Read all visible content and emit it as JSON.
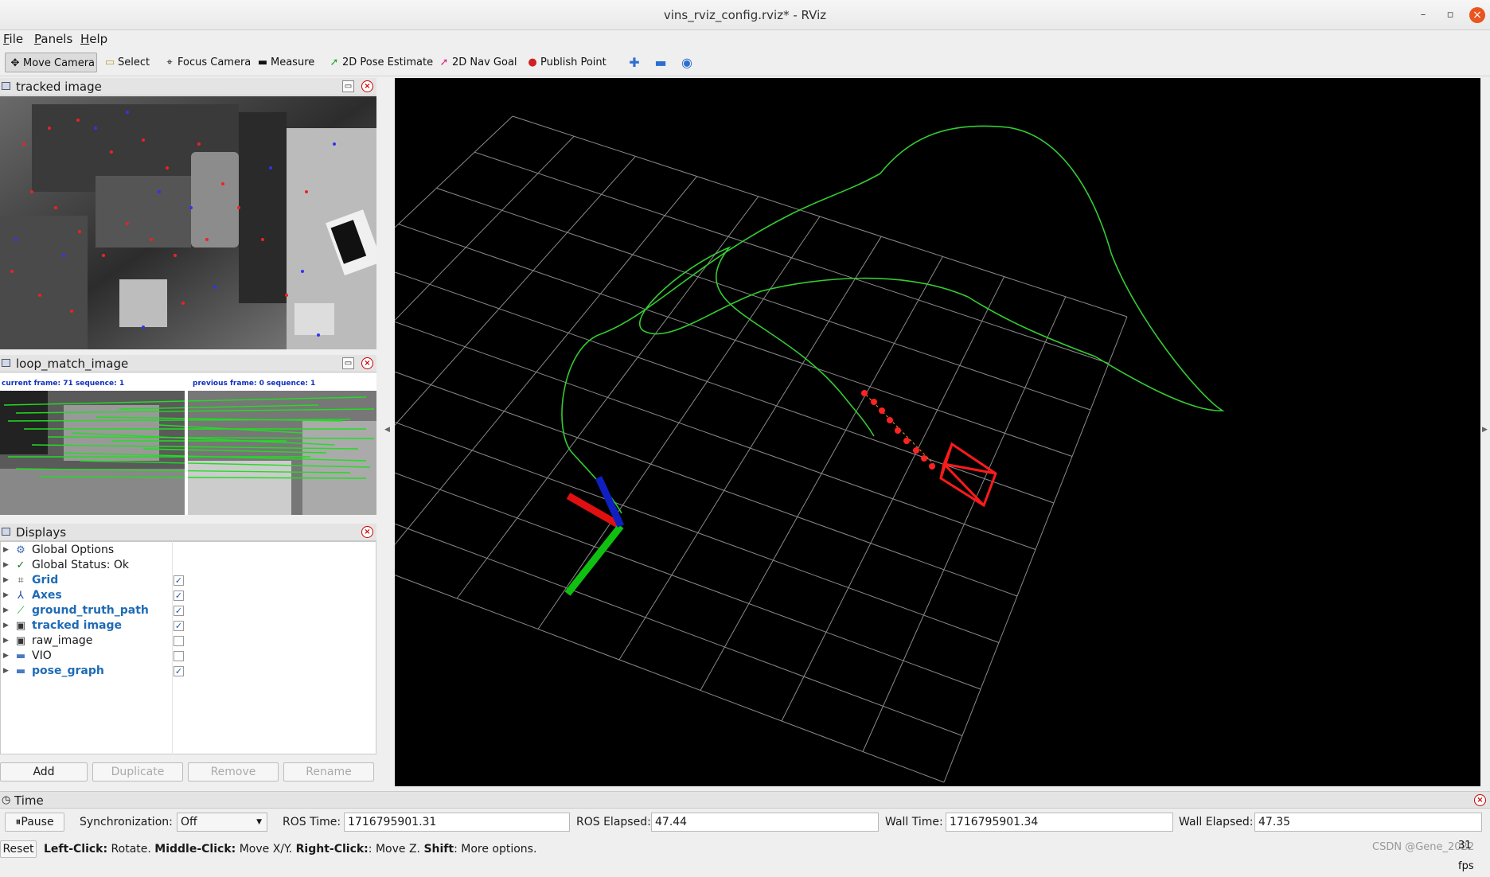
{
  "window": {
    "title": "vins_rviz_config.rviz* - RViz"
  },
  "menu": [
    {
      "label": "File",
      "accel": "F",
      "rest": "ile"
    },
    {
      "label": "Panels",
      "accel": "P",
      "rest": "anels"
    },
    {
      "label": "Help",
      "accel": "H",
      "rest": "elp"
    }
  ],
  "toolbar": {
    "move_camera": "Move Camera",
    "select": "Select",
    "focus_camera": "Focus Camera",
    "measure": "Measure",
    "pose_estimate": "2D Pose Estimate",
    "nav_goal": "2D Nav Goal",
    "publish_point": "Publish Point"
  },
  "panels": {
    "tracked_image": {
      "title": "tracked image"
    },
    "loop_match": {
      "title": "loop_match_image",
      "current_frame": "current frame: 71   sequence: 1",
      "previous_frame": "previous frame: 0   sequence: 1"
    }
  },
  "displays": {
    "title": "Displays",
    "items": [
      {
        "label": "Global Options",
        "icon": "gear-icon",
        "bold": false,
        "checkbox": null
      },
      {
        "label": "Global Status: Ok",
        "icon": "check-icon",
        "bold": false,
        "checkbox": null
      },
      {
        "label": "Grid",
        "icon": "grid-icon",
        "bold": true,
        "checkbox": true
      },
      {
        "label": "Axes",
        "icon": "axes-icon",
        "bold": true,
        "checkbox": true
      },
      {
        "label": "ground_truth_path",
        "icon": "path-icon",
        "bold": true,
        "checkbox": true
      },
      {
        "label": "tracked image",
        "icon": "image-icon",
        "bold": true,
        "checkbox": true
      },
      {
        "label": "raw_image",
        "icon": "image-icon",
        "bold": false,
        "checkbox": false
      },
      {
        "label": "VIO",
        "icon": "folder-icon",
        "bold": false,
        "checkbox": false
      },
      {
        "label": "pose_graph",
        "icon": "folder-icon",
        "bold": true,
        "checkbox": true
      }
    ],
    "buttons": {
      "add": "Add",
      "duplicate": "Duplicate",
      "remove": "Remove",
      "rename": "Rename"
    }
  },
  "time": {
    "title": "Time",
    "pause": "Pause",
    "sync_label": "Synchronization:",
    "sync_value": "Off",
    "ros_time_label": "ROS Time:",
    "ros_time": "1716795901.31",
    "ros_elapsed_label": "ROS Elapsed:",
    "ros_elapsed": "47.44",
    "wall_time_label": "Wall Time:",
    "wall_time": "1716795901.34",
    "wall_elapsed_label": "Wall Elapsed:",
    "wall_elapsed": "47.35"
  },
  "status": {
    "reset": "Reset",
    "left_click": "Left-Click:",
    "left_desc": " Rotate. ",
    "middle_click": "Middle-Click:",
    "middle_desc": " Move X/Y. ",
    "right_click": "Right-Click:",
    "right_desc": ": Move Z. ",
    "shift": "Shift",
    "shift_desc": ": More options.",
    "fps": "31 fps",
    "watermark": "CSDN @Gene_2022"
  },
  "colors": {
    "path": "#33cc33",
    "axis_x": "#e01010",
    "axis_y": "#10c010",
    "axis_z": "#1020c0",
    "camera": "#ff1a1a",
    "grid": "#9a9a9a"
  }
}
